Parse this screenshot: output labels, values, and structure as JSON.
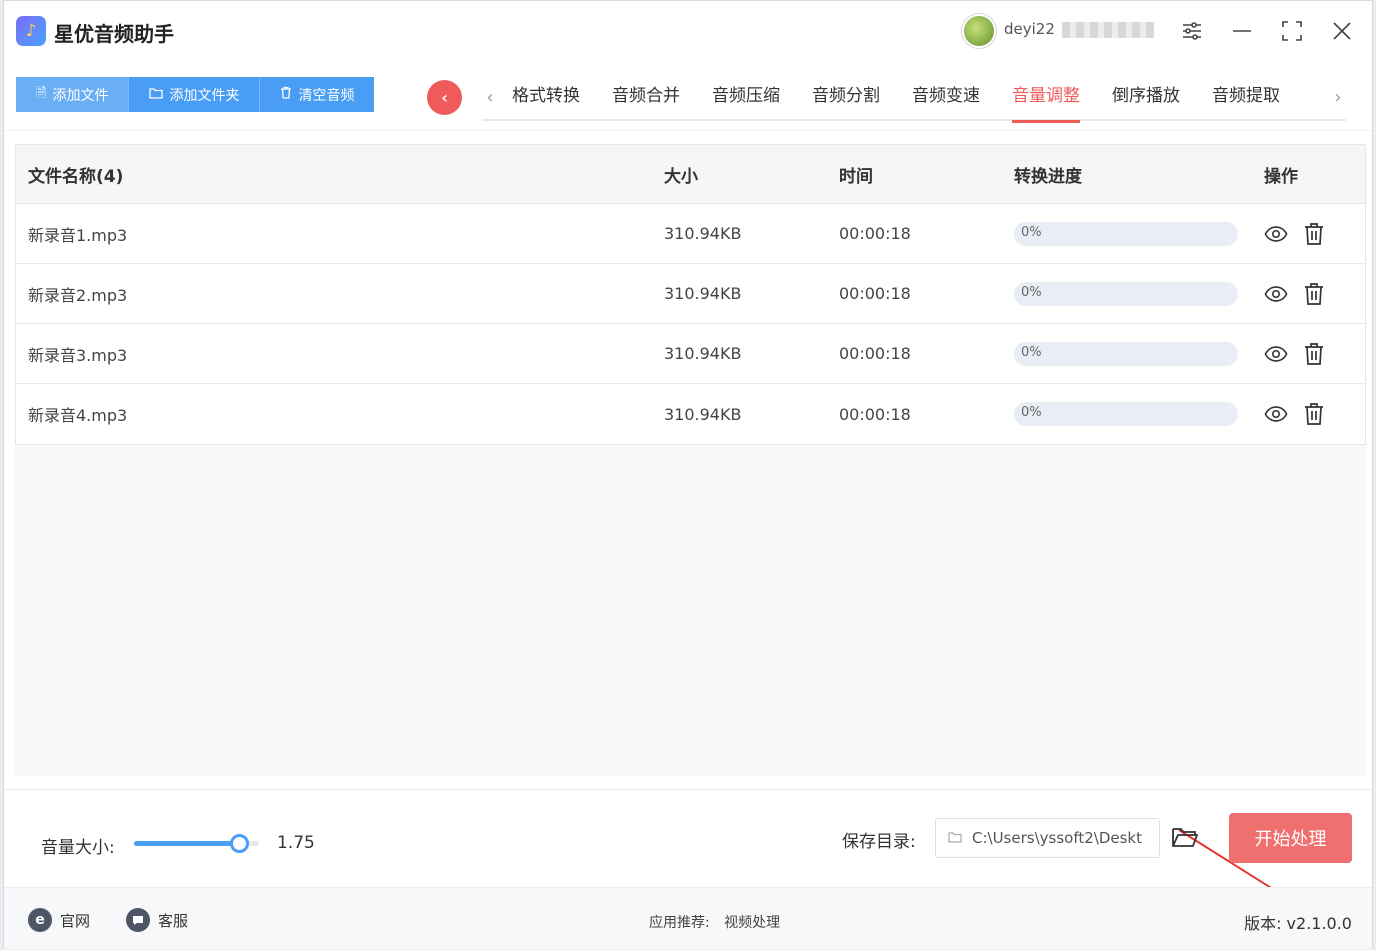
{
  "app": {
    "title": "星优音频助手",
    "user_name": "deyi22"
  },
  "toolbar": {
    "add_file": "添加文件",
    "add_folder": "添加文件夹",
    "clear_audio": "清空音频"
  },
  "tabs": [
    {
      "label": "格式转换",
      "active": false
    },
    {
      "label": "音频合并",
      "active": false
    },
    {
      "label": "音频压缩",
      "active": false
    },
    {
      "label": "音频分割",
      "active": false
    },
    {
      "label": "音频变速",
      "active": false
    },
    {
      "label": "音量调整",
      "active": true
    },
    {
      "label": "倒序播放",
      "active": false
    },
    {
      "label": "音频提取",
      "active": false
    }
  ],
  "table": {
    "headers": {
      "name": "文件名称(4)",
      "size": "大小",
      "time": "时间",
      "progress": "转换进度",
      "ops": "操作"
    },
    "rows": [
      {
        "name": "新录音1.mp3",
        "size": "310.94KB",
        "time": "00:00:18",
        "progress": "0%",
        "progress_value": 0
      },
      {
        "name": "新录音2.mp3",
        "size": "310.94KB",
        "time": "00:00:18",
        "progress": "0%",
        "progress_value": 0
      },
      {
        "name": "新录音3.mp3",
        "size": "310.94KB",
        "time": "00:00:18",
        "progress": "0%",
        "progress_value": 0
      },
      {
        "name": "新录音4.mp3",
        "size": "310.94KB",
        "time": "00:00:18",
        "progress": "0%",
        "progress_value": 0
      }
    ]
  },
  "settings": {
    "volume_label": "音量大小:",
    "volume_value": "1.75",
    "volume_fraction": 0.84,
    "save_label": "保存目录:",
    "save_path": "C:\\Users\\yssoft2\\Deskt",
    "start_button": "开始处理"
  },
  "footer": {
    "website": "官网",
    "support": "客服",
    "recommend_label": "应用推荐:",
    "recommend_value": "视频处理",
    "version": "版本:  v2.1.0.0"
  },
  "colors": {
    "accent_blue": "#4a9df5",
    "accent_red": "#ef5a5a",
    "start_btn": "#f07070"
  }
}
